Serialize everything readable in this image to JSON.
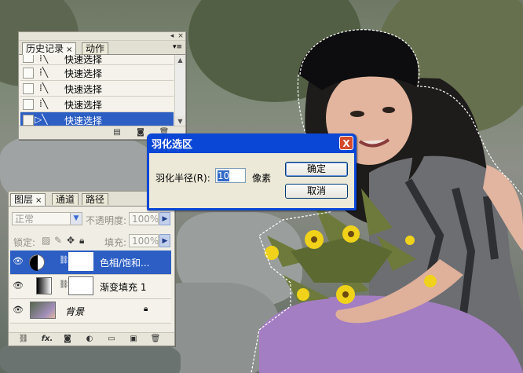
{
  "history_panel": {
    "tabs": [
      {
        "label": "历史记录"
      },
      {
        "label": "动作"
      }
    ],
    "close_tab_glyph": "×",
    "menu_glyph": "▾≡",
    "rows": [
      {
        "label": "快速选择",
        "selected": false
      },
      {
        "label": "快速选择",
        "selected": false
      },
      {
        "label": "快速选择",
        "selected": false
      },
      {
        "label": "快速选择",
        "selected": false
      },
      {
        "label": "快速选择",
        "selected": true
      }
    ],
    "footer_icons": [
      "new-document-from-state-icon",
      "new-snapshot-icon",
      "delete-state-icon"
    ]
  },
  "layers_panel": {
    "tabs": [
      {
        "label": "图层"
      },
      {
        "label": "通道"
      },
      {
        "label": "路径"
      }
    ],
    "close_tab_glyph": "×",
    "blend_mode": "正常",
    "opacity_label": "不透明度:",
    "opacity_value": "100%",
    "lock_label": "锁定:",
    "fill_label": "填充:",
    "fill_value": "100%",
    "layers": [
      {
        "name": "色相/饱和...",
        "selected": true
      },
      {
        "name": "渐变填充 1",
        "selected": false
      },
      {
        "name": "背景",
        "selected": false
      }
    ],
    "footer_icons": [
      "link-layers-icon",
      "fx-icon",
      "add-mask-icon",
      "adjustment-layer-icon",
      "new-group-icon",
      "new-layer-icon",
      "delete-layer-icon"
    ],
    "fx_text": "fx."
  },
  "dialog": {
    "title": "羽化选区",
    "close_glyph": "X",
    "radius_label": "羽化半径(R):",
    "radius_value": "10",
    "unit": "像素",
    "ok_label": "确定",
    "cancel_label": "取消"
  },
  "colors": {
    "selection_blue": "#2c5ec3",
    "dialog_title_blue": "#0a47d6",
    "panel_bg": "#f0eee4"
  }
}
